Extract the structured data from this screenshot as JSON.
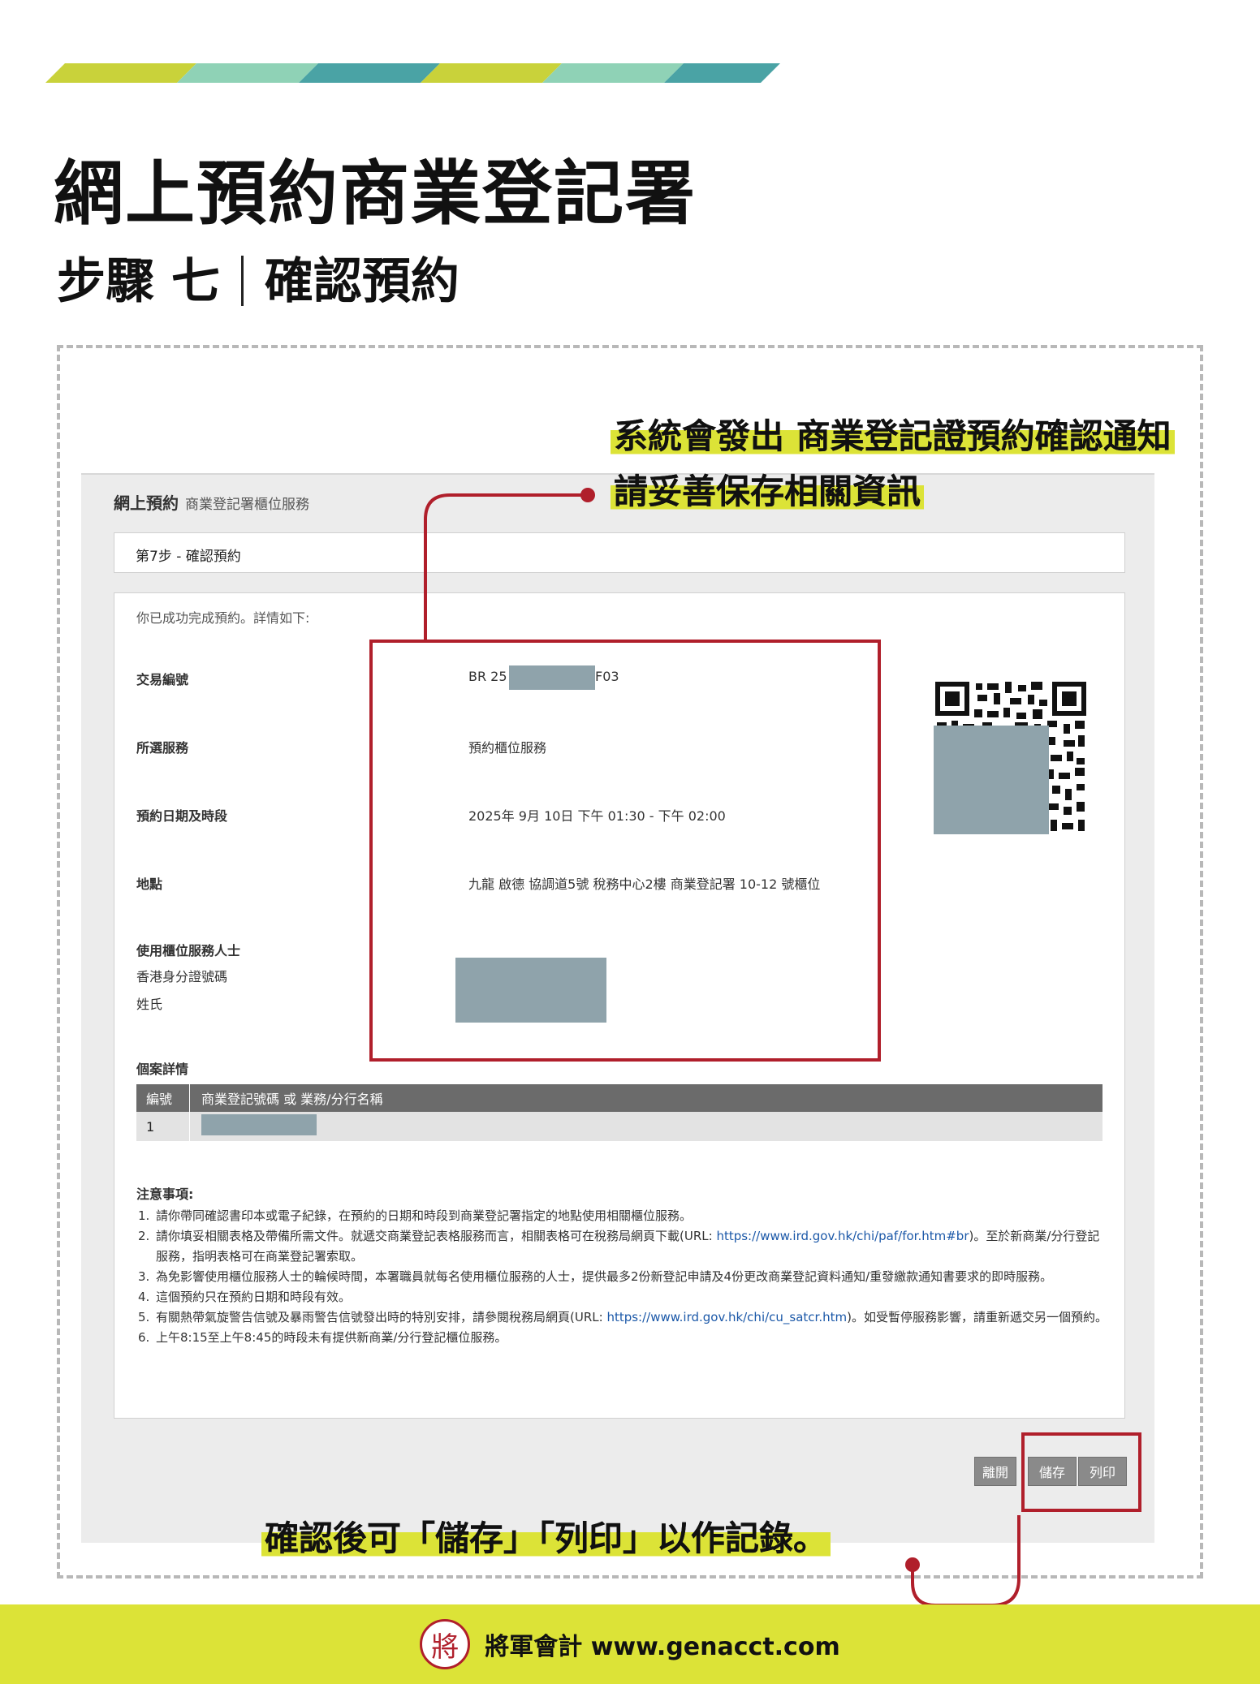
{
  "header": {
    "title": "網上預約商業登記署",
    "step": "步驟 七",
    "step_name": "確認預約"
  },
  "callouts": {
    "top_line1": "系統會發出 商業登記證預約確認通知",
    "top_line2": "請妥善保存相關資訊",
    "bottom": "確認後可「儲存」「列印」以作記錄。"
  },
  "screen": {
    "service_title": "網上預約",
    "service_subtitle": "商業登記署櫃位服務",
    "step_label": "第7步 - 確認預約",
    "intro": "你已成功完成預約。詳情如下:",
    "fields": {
      "txn_label": "交易編號",
      "txn_prefix": "BR 25",
      "txn_suffix": "F03",
      "service_label": "所選服務",
      "service_value": "預約櫃位服務",
      "date_label": "預約日期及時段",
      "date_value": "2025年 9月 10日 下午 01:30 - 下午 02:00",
      "location_label": "地點",
      "location_value": "九龍 啟德 協調道5號 稅務中心2樓 商業登記署 10-12 號櫃位",
      "person_label": "使用櫃位服務人士",
      "hkid_label": "香港身分證號碼",
      "name_label": "姓氏"
    },
    "case": {
      "title": "個案詳情",
      "col_no": "編號",
      "col_name": "商業登記號碼 或 業務/分行名稱",
      "row_no": "1"
    },
    "notes": {
      "title": "注意事項:",
      "items": {
        "n1": "1.",
        "t1": "請你帶同確認書印本或電子紀錄，在預約的日期和時段到商業登記署指定的地點使用相關櫃位服務。",
        "n2": "2.",
        "t2a": "請你填妥相關表格及帶備所需文件。就遞交商業登記表格服務而言，相關表格可在稅務局網頁下載(URL: ",
        "t2link": "https://www.ird.gov.hk/chi/paf/for.htm#br",
        "t2b": ")。至於新商業/分行登記服務，指明表格可在商業登記署索取。",
        "n3": "3.",
        "t3": "為免影響使用櫃位服務人士的輪候時間，本署職員就每名使用櫃位服務的人士，提供最多2份新登記申請及4份更改商業登記資料通知/重發繳款通知書要求的即時服務。",
        "n4": "4.",
        "t4": "這個預約只在預約日期和時段有效。",
        "n5": "5.",
        "t5a": "有關熱帶氣旋警告信號及暴雨警告信號發出時的特別安排，請參閱稅務局網頁(URL: ",
        "t5link": "https://www.ird.gov.hk/chi/cu_satcr.htm",
        "t5b": ")。如受暫停服務影響，請重新遞交另一個預約。",
        "n6": "6.",
        "t6": "上午8:15至上午8:45的時段未有提供新商業/分行登記櫃位服務。"
      }
    },
    "buttons": {
      "leave": "離開",
      "save": "儲存",
      "print": "列印"
    }
  },
  "footer": {
    "seal_char": "將",
    "brand": "將軍會計 www.genacct.com"
  },
  "colors": {
    "accent_red": "#b01f2b",
    "accent_yellow": "#dce337",
    "stripe_teal": "#4aa3a5",
    "stripe_mint": "#8fd2b6",
    "redaction": "#8fa3ab"
  }
}
